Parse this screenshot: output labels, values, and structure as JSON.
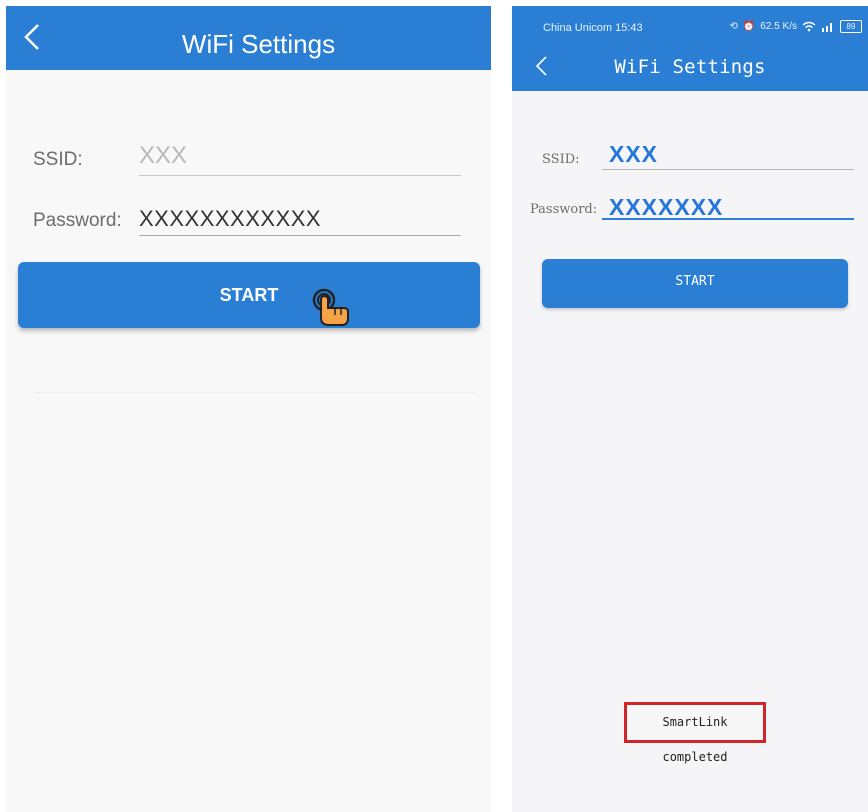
{
  "left_screen": {
    "header": {
      "title": "WiFi Settings"
    },
    "form": {
      "ssid_label": "SSID:",
      "ssid_value": "XXX",
      "password_label": "Password:",
      "password_value": "XXXXXXXXXXXX"
    },
    "start_label": "START",
    "colors": {
      "accent": "#2a7fd5",
      "background": "#f8f8f8"
    }
  },
  "right_screen": {
    "status_bar": {
      "carrier": "China  Unicom 15:43",
      "net_speed": "62.5 K/s",
      "battery": "89"
    },
    "header": {
      "title": "WiFi Settings"
    },
    "form": {
      "ssid_label": "SSID:",
      "ssid_value": "XXX",
      "password_label": "Password:",
      "password_value": "XXXXXXX"
    },
    "start_label": "START",
    "toast": "SmartLink completed",
    "colors": {
      "accent": "#2a7fd5",
      "highlight": "#d0262a",
      "value_text": "#2677d9"
    }
  }
}
